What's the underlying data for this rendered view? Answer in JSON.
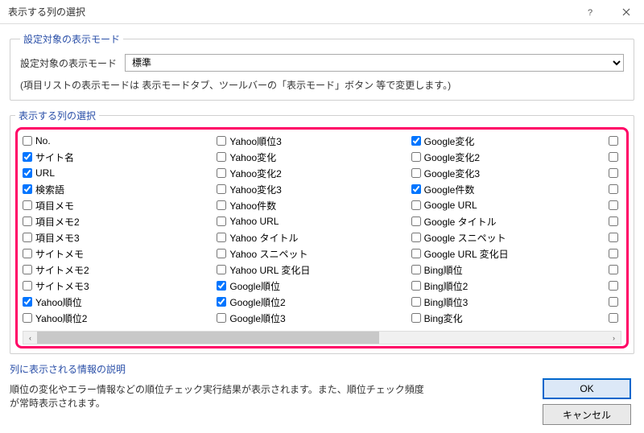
{
  "title": "表示する列の選択",
  "group1": {
    "legend": "設定対象の表示モード",
    "mode_label": "設定対象の表示モード",
    "mode_value": "標準",
    "hint": "(項目リストの表示モードは 表示モードタブ、ツールバーの「表示モード」ボタン 等で変更します。)"
  },
  "group2": {
    "legend": "表示する列の選択",
    "col1": [
      {
        "label": "No.",
        "checked": false
      },
      {
        "label": "サイト名",
        "checked": true
      },
      {
        "label": "URL",
        "checked": true
      },
      {
        "label": "検索語",
        "checked": true
      },
      {
        "label": "項目メモ",
        "checked": false
      },
      {
        "label": "項目メモ2",
        "checked": false
      },
      {
        "label": "項目メモ3",
        "checked": false
      },
      {
        "label": "サイトメモ",
        "checked": false
      },
      {
        "label": "サイトメモ2",
        "checked": false
      },
      {
        "label": "サイトメモ3",
        "checked": false
      },
      {
        "label": "Yahoo順位",
        "checked": true
      },
      {
        "label": "Yahoo順位2",
        "checked": false
      }
    ],
    "col2": [
      {
        "label": "Yahoo順位3",
        "checked": false
      },
      {
        "label": "Yahoo変化",
        "checked": false
      },
      {
        "label": "Yahoo変化2",
        "checked": false
      },
      {
        "label": "Yahoo変化3",
        "checked": false
      },
      {
        "label": "Yahoo件数",
        "checked": false
      },
      {
        "label": "Yahoo URL",
        "checked": false
      },
      {
        "label": "Yahoo タイトル",
        "checked": false
      },
      {
        "label": "Yahoo スニペット",
        "checked": false
      },
      {
        "label": "Yahoo URL 変化日",
        "checked": false
      },
      {
        "label": "Google順位",
        "checked": true
      },
      {
        "label": "Google順位2",
        "checked": true
      },
      {
        "label": "Google順位3",
        "checked": false
      }
    ],
    "col3": [
      {
        "label": "Google変化",
        "checked": true
      },
      {
        "label": "Google変化2",
        "checked": false
      },
      {
        "label": "Google変化3",
        "checked": false
      },
      {
        "label": "Google件数",
        "checked": true
      },
      {
        "label": "Google URL",
        "checked": false
      },
      {
        "label": "Google タイトル",
        "checked": false
      },
      {
        "label": "Google スニペット",
        "checked": false
      },
      {
        "label": "Google URL 変化日",
        "checked": false
      },
      {
        "label": "Bing順位",
        "checked": false
      },
      {
        "label": "Bing順位2",
        "checked": false
      },
      {
        "label": "Bing順位3",
        "checked": false
      },
      {
        "label": "Bing変化",
        "checked": false
      }
    ]
  },
  "desc": {
    "legend": "列に表示される情報の説明",
    "text": "順位の変化やエラー情報などの順位チェック実行結果が表示されます。また、順位チェック頻度が常時表示されます。"
  },
  "buttons": {
    "ok": "OK",
    "cancel": "キャンセル"
  },
  "scroll": {
    "left": "‹",
    "right": "›"
  }
}
